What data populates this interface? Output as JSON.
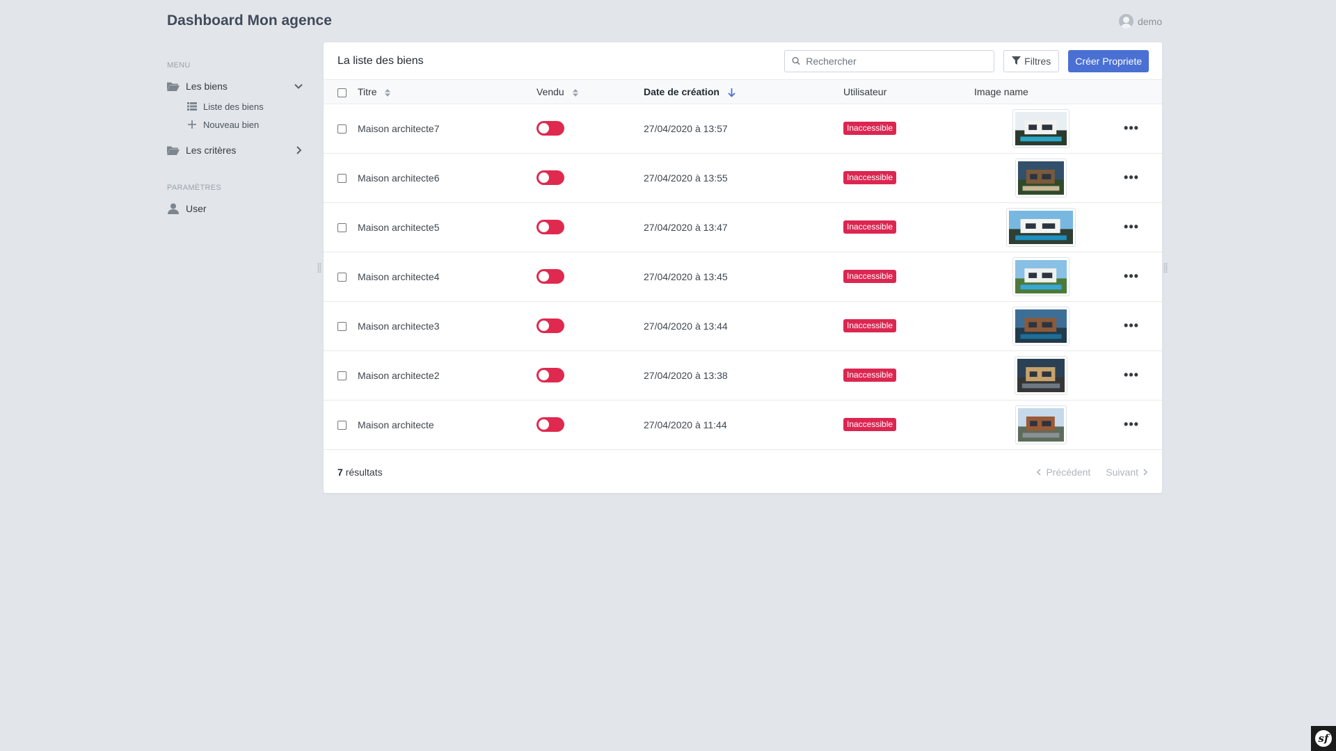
{
  "header": {
    "app_title": "Dashboard Mon agence",
    "username": "demo"
  },
  "sidebar": {
    "menu_label": "MENU",
    "groups": [
      {
        "label": "Les biens",
        "expanded": true,
        "items": [
          {
            "label": "Liste des biens",
            "icon": "list-icon"
          },
          {
            "label": "Nouveau bien",
            "icon": "plus-icon"
          }
        ]
      },
      {
        "label": "Les critères",
        "expanded": false
      }
    ],
    "params_label": "PARAMÈTRES",
    "params_items": [
      {
        "label": "User",
        "icon": "user-icon"
      }
    ]
  },
  "panel": {
    "title": "La liste des biens",
    "search_placeholder": "Rechercher",
    "filters_label": "Filtres",
    "create_label": "Créer Propriete",
    "columns": {
      "title": "Titre",
      "vendu": "Vendu",
      "date": "Date de création",
      "user": "Utilisateur",
      "image": "Image name"
    },
    "rows": [
      {
        "title": "Maison architecte7",
        "vendu": false,
        "date": "27/04/2020 à 13:57",
        "user": "Inaccessible"
      },
      {
        "title": "Maison architecte6",
        "vendu": false,
        "date": "27/04/2020 à 13:55",
        "user": "Inaccessible"
      },
      {
        "title": "Maison architecte5",
        "vendu": false,
        "date": "27/04/2020 à 13:47",
        "user": "Inaccessible"
      },
      {
        "title": "Maison architecte4",
        "vendu": false,
        "date": "27/04/2020 à 13:45",
        "user": "Inaccessible"
      },
      {
        "title": "Maison architecte3",
        "vendu": false,
        "date": "27/04/2020 à 13:44",
        "user": "Inaccessible"
      },
      {
        "title": "Maison architecte2",
        "vendu": false,
        "date": "27/04/2020 à 13:38",
        "user": "Inaccessible"
      },
      {
        "title": "Maison architecte",
        "vendu": false,
        "date": "27/04/2020 à 11:44",
        "user": "Inaccessible"
      }
    ],
    "footer": {
      "count": "7",
      "count_suffix": "résultats",
      "prev_label": "Précédent",
      "next_label": "Suivant"
    }
  },
  "colors": {
    "background": "#e2e6ea",
    "primary": "#4a70d4",
    "danger": "#dc2651"
  }
}
